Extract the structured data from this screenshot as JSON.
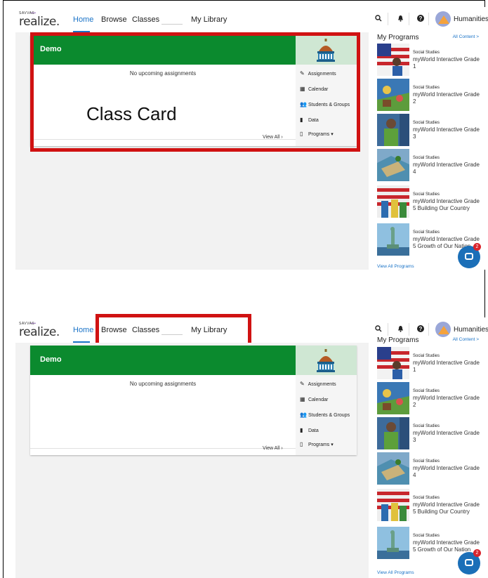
{
  "app": {
    "brand_small": "SAVVAS",
    "brand_dots": "••••",
    "brand_word": "realize."
  },
  "nav": {
    "home": "Home",
    "browse": "Browse",
    "classes": "Classes",
    "my_library": "My Library"
  },
  "user": {
    "name": "Humanities ▾"
  },
  "icons": {
    "search": "search-icon",
    "bell": "bell-icon",
    "help": "help-icon"
  },
  "card": {
    "title": "Demo",
    "no_assignments": "No upcoming assignments",
    "actions": [
      {
        "icon": "✎",
        "label": "Assignments"
      },
      {
        "icon": "▦",
        "label": "Calendar"
      },
      {
        "icon": "👥",
        "label": "Students & Groups"
      },
      {
        "icon": "▮",
        "label": "Data"
      },
      {
        "icon": "▯",
        "label": "Programs  ▾"
      }
    ],
    "view_all": "View All ›"
  },
  "annotation": {
    "label": "Class Card"
  },
  "sidebar": {
    "title": "My Programs",
    "all_content": "All Content >",
    "programs": [
      {
        "subject": "Social Studies",
        "name": "myWorld Interactive Grade 1"
      },
      {
        "subject": "Social Studies",
        "name": "myWorld Interactive Grade 2"
      },
      {
        "subject": "Social Studies",
        "name": "myWorld Interactive Grade 3"
      },
      {
        "subject": "Social Studies",
        "name": "myWorld Interactive Grade 4"
      },
      {
        "subject": "Social Studies",
        "name": "myWorld Interactive Grade 5 Building Our Country"
      },
      {
        "subject": "Social Studies",
        "name": "myWorld Interactive Grade 5 Growth of Our Nation"
      }
    ],
    "view_all": "View All Programs"
  },
  "chat": {
    "badge": "2"
  },
  "colors": {
    "accent": "#1a73c7",
    "card_header": "#0b8a2e",
    "highlight": "#d01212"
  }
}
